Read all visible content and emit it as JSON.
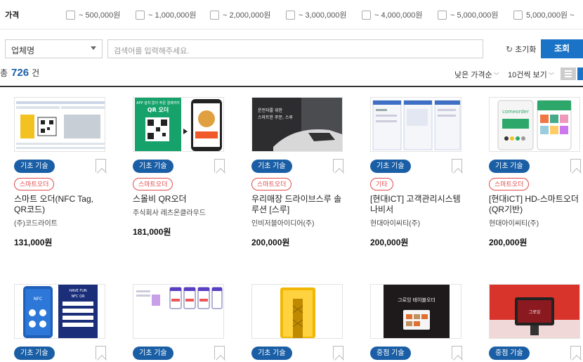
{
  "filters": {
    "price_label": "가격",
    "price_options": [
      "~ 500,000원",
      "~ 1,000,000원",
      "~ 2,000,000원",
      "~ 3,000,000원",
      "~ 4,000,000원",
      "~ 5,000,000원",
      "5,000,000원 ~"
    ]
  },
  "search": {
    "select_value": "업체명",
    "placeholder": "검색어를 입력해주세요.",
    "reset_label": "초기화",
    "submit_label": "조회"
  },
  "results": {
    "total_prefix": "총",
    "total_count": "726",
    "total_suffix": "건",
    "sort_label": "낮은 가격순",
    "per_page_label": "10건씩 보기"
  },
  "products": [
    {
      "category": "기초 기술",
      "tag": "스마트오더",
      "title": "스마트 오더(NFC Tag, QR코드)",
      "company": "(주)코드라이트",
      "price": "131,000원"
    },
    {
      "category": "기초 기술",
      "tag": "스마트오더",
      "title": "스몰비 QR오더",
      "company": "주식회사 레츠온클라우드",
      "price": "181,000원"
    },
    {
      "category": "기초 기술",
      "tag": "스마트오더",
      "title": "우리매장 드라이브스루 솔루션 [스루]",
      "company": "인비저블아이디어(주)",
      "price": "200,000원"
    },
    {
      "category": "기초 기술",
      "tag": "기타",
      "title": "[현대ICT] 고객관리시스템 나비서",
      "company": "현대아이씨티(주)",
      "price": "200,000원"
    },
    {
      "category": "기초 기술",
      "tag": "스마트오더",
      "title": "[현대ICT] HD-스마트오더(QR기반)",
      "company": "현대아이씨티(주)",
      "price": "200,000원"
    },
    {
      "category": "기초 기술"
    },
    {
      "category": "기초 기술"
    },
    {
      "category": "기초 기술"
    },
    {
      "category": "중점 기술"
    },
    {
      "category": "중점 기술"
    }
  ],
  "thumbnails": {
    "p2_text": "APP 설치 없이 주문 결제까지\nQR 오더",
    "p3_text": "운전자를 위한\n스마트한 주문, 스루",
    "p5_text": "comeorder",
    "p6_text": "HAVE FUN\nNFC QR",
    "p9_text": "그로잉 테이블오더",
    "p10_text": "그로잉"
  },
  "colors": {
    "accent": "#1a73c6",
    "badge": "#1a5fa6",
    "tag": "#e04a4a"
  }
}
